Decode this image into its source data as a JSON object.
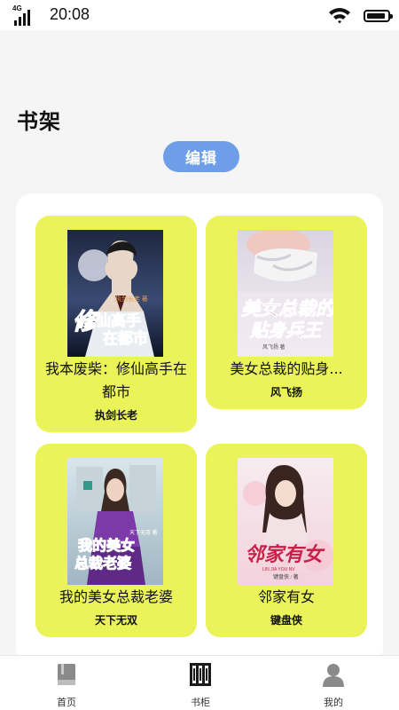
{
  "status_bar": {
    "network": "4G",
    "time": "20:08",
    "signal_bars": 4,
    "battery_level": 0.75
  },
  "header": {
    "title": "书架",
    "edit_label": "编辑"
  },
  "books": [
    {
      "title": "我本废柴：修仙高手在都市",
      "author": "执剑长老",
      "cover_text": "修仙高手在都市",
      "cover_small_text": "执剑长老 著"
    },
    {
      "title": "美女总裁的贴身...",
      "author": "风飞扬",
      "cover_text": "美女总裁的贴身兵王",
      "cover_small_text": "风飞扬 著"
    },
    {
      "title": "我的美女总裁老婆",
      "author": "天下无双",
      "cover_text": "我的美女总裁老婆",
      "cover_small_text": "天下无双 著"
    },
    {
      "title": "邻家有女",
      "author": "键盘侠",
      "cover_text": "邻家有女",
      "cover_small_text": "LIN JIA YOU NV",
      "cover_author_text": "键盘侠 / 著"
    }
  ],
  "nav": [
    {
      "label": "首页",
      "icon": "book-icon"
    },
    {
      "label": "书柜",
      "icon": "bookshelf-icon",
      "active": true
    },
    {
      "label": "我的",
      "icon": "user-icon"
    }
  ]
}
